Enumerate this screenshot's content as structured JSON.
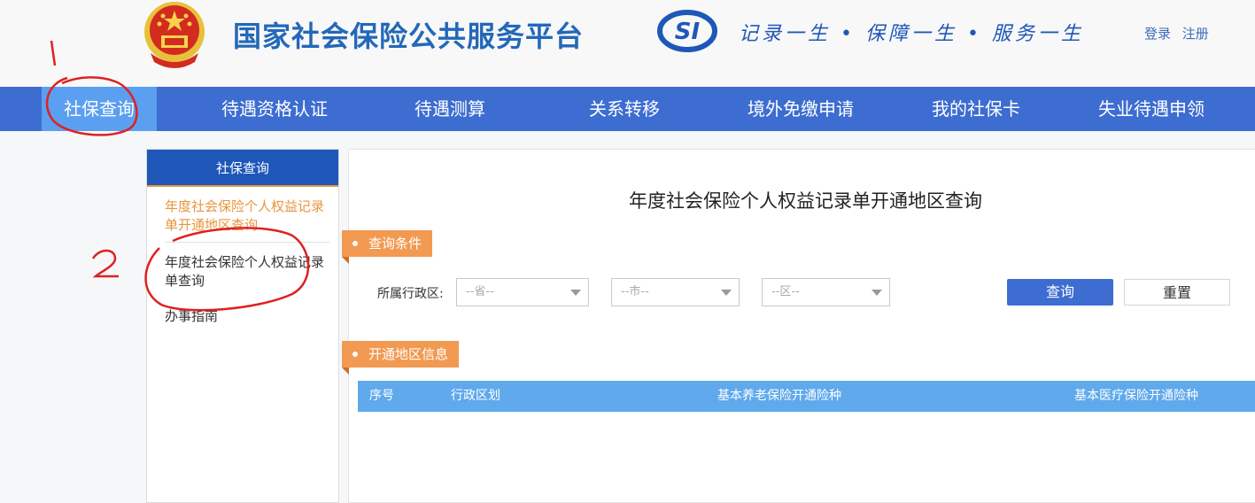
{
  "header": {
    "site_title": "国家社会保险公共服务平台",
    "si_logo_text": "SI",
    "slogan": "记录一生 • 保障一生 • 服务一生",
    "login": "登录",
    "register": "注册"
  },
  "nav": {
    "items": [
      {
        "label": "社保查询"
      },
      {
        "label": "待遇资格认证"
      },
      {
        "label": "待遇测算"
      },
      {
        "label": "关系转移"
      },
      {
        "label": "境外免缴申请"
      },
      {
        "label": "我的社保卡"
      },
      {
        "label": "失业待遇申领"
      }
    ]
  },
  "sidebar": {
    "title": "社保查询",
    "items": [
      {
        "label": "年度社会保险个人权益记录单开通地区查询"
      },
      {
        "label": "年度社会保险个人权益记录单查询"
      },
      {
        "label": "办事指南"
      }
    ]
  },
  "main": {
    "title": "年度社会保险个人权益记录单开通地区查询",
    "query_section": "查询条件",
    "region_label": "所属行政区:",
    "province_placeholder": "--省--",
    "city_placeholder": "--市--",
    "district_placeholder": "--区--",
    "query_button": "查询",
    "reset_button": "重置",
    "info_section": "开通地区信息",
    "table_headers": [
      "序号",
      "行政区划",
      "基本养老保险开通险种",
      "基本医疗保险开通险种"
    ]
  },
  "annotations": {
    "mark1": "1",
    "mark2": "2"
  },
  "colors": {
    "nav_bg": "#3d6dd0",
    "nav_active": "#5b9ff0",
    "accent_orange": "#f29a52",
    "table_head": "#5fa9ec",
    "annotation_red": "#e02020"
  }
}
